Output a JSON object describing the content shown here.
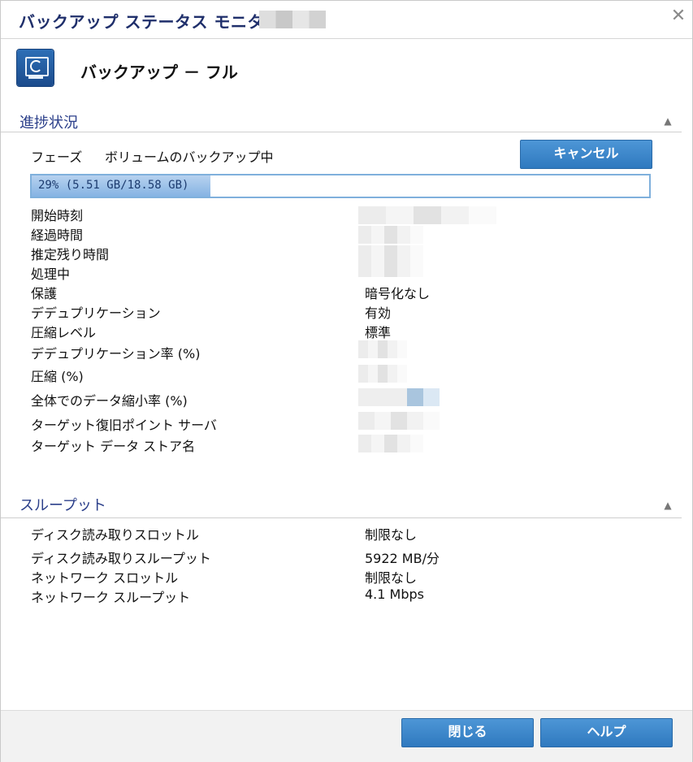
{
  "window": {
    "title": "バックアップ ステータス モニタ -",
    "close_symbol": "✕"
  },
  "job": {
    "icon": "backup-monitor-icon",
    "title": "バックアップ － フル"
  },
  "progress_section": {
    "header": "進捗状況",
    "phase_label": "フェーズ",
    "phase_value": "ボリュームのバックアップ中",
    "cancel_button": "キャンセル",
    "progress_percent": 29,
    "progress_text": "29% (5.51 GB/18.58 GB)",
    "rows": [
      {
        "label": "開始時刻",
        "value": ""
      },
      {
        "label": "経過時間",
        "value": ""
      },
      {
        "label": "推定残り時間",
        "value": ""
      },
      {
        "label": "処理中",
        "value": ""
      },
      {
        "label": "保護",
        "value": "暗号化なし"
      },
      {
        "label": "デデュプリケーション",
        "value": "有効"
      },
      {
        "label": "圧縮レベル",
        "value": "標準"
      },
      {
        "label": "デデュプリケーション率 (%)",
        "value": ""
      },
      {
        "label": "圧縮 (%)",
        "value": ""
      },
      {
        "label": "全体でのデータ縮小率 (%)",
        "value": ""
      },
      {
        "label": "ターゲット復旧ポイント サーバ",
        "value": ""
      },
      {
        "label": "ターゲット データ ストア名",
        "value": ""
      }
    ]
  },
  "throughput_section": {
    "header": "スループット",
    "rows": [
      {
        "label": "ディスク読み取りスロットル",
        "value": "制限なし"
      },
      {
        "label": "ディスク読み取りスループット",
        "value": "5922 MB/分"
      },
      {
        "label": "ネットワーク スロットル",
        "value": "制限なし"
      },
      {
        "label": "ネットワーク スループット",
        "value": "4.1 Mbps"
      }
    ]
  },
  "footer": {
    "close_button": "閉じる",
    "help_button": "ヘルプ"
  },
  "colors": {
    "title": "#1f2f6b",
    "section_header": "#2b3f8a",
    "button": "#3a86cc",
    "progress_fill": "#9ec3ea"
  }
}
